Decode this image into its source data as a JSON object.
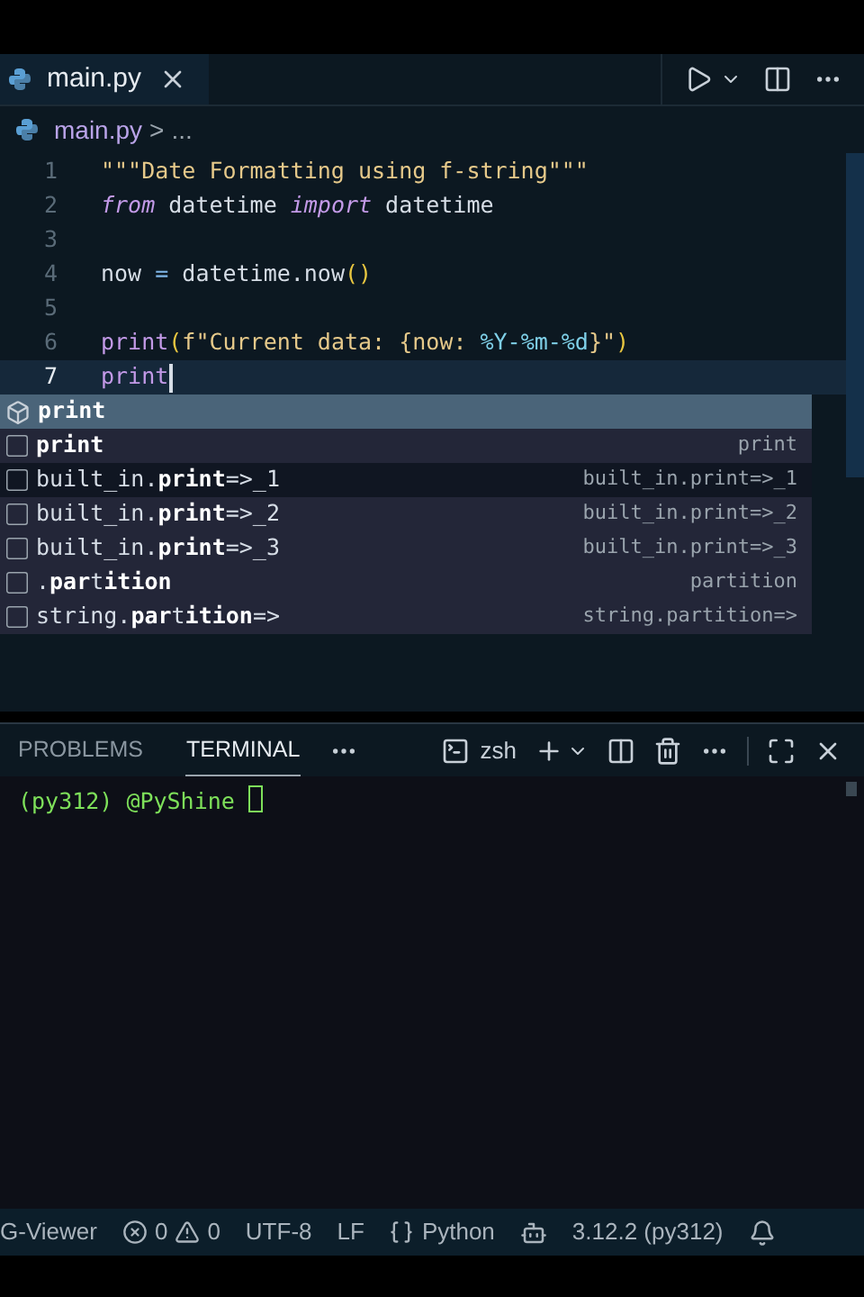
{
  "tabs": [
    {
      "label": "main.py",
      "selected": true
    }
  ],
  "breadcrumb": {
    "file": "main.py",
    "separator": ">",
    "rest": "..."
  },
  "editor": {
    "lines": [
      {
        "number": "1",
        "current": false,
        "tokens": [
          {
            "kind": "string",
            "text": "\"\"\"Date Formatting using f-string\"\"\""
          }
        ]
      },
      {
        "number": "2",
        "current": false,
        "tokens": [
          {
            "kind": "keyword",
            "text": "from"
          },
          {
            "kind": "plain",
            "text": " datetime "
          },
          {
            "kind": "keyword",
            "text": "import"
          },
          {
            "kind": "plain",
            "text": " datetime"
          }
        ]
      },
      {
        "number": "3",
        "current": false
      },
      {
        "number": "4",
        "current": false,
        "tokens": [
          {
            "kind": "plain",
            "text": "now "
          },
          {
            "kind": "operator",
            "text": "="
          },
          {
            "kind": "plain",
            "text": " datetime.now"
          },
          {
            "kind": "paren",
            "text": "()"
          }
        ]
      },
      {
        "number": "5",
        "current": false
      },
      {
        "number": "6",
        "current": false,
        "tokens": [
          {
            "kind": "function",
            "text": "print"
          },
          {
            "kind": "paren",
            "text": "("
          },
          {
            "kind": "string",
            "text": "f\"Current data: "
          },
          {
            "kind": "brace",
            "text": "{now: "
          },
          {
            "kind": "format",
            "text": "%Y-%m-%d"
          },
          {
            "kind": "brace",
            "text": "}"
          },
          {
            "kind": "string",
            "text": "\""
          },
          {
            "kind": "paren",
            "text": ")"
          }
        ]
      },
      {
        "number": "7",
        "current": true,
        "tokens": [
          {
            "kind": "function",
            "text": "print"
          }
        ]
      }
    ]
  },
  "suggestions": [
    {
      "kind": "module",
      "label": "print",
      "bold": true,
      "selected": true,
      "hovered": false
    },
    {
      "kind": "text",
      "label": "print",
      "bold": true,
      "detail": "print",
      "selected": false,
      "hovered": false
    },
    {
      "kind": "text",
      "label": "built_in.**print**=>_1",
      "detail": "built_in.print=>_1",
      "selected": false,
      "hovered": true
    },
    {
      "kind": "text",
      "label": "built_in.**print**=>_2",
      "detail": "built_in.print=>_2",
      "selected": false,
      "hovered": false
    },
    {
      "kind": "text",
      "label": "built_in.**print**=>_3",
      "detail": "built_in.print=>_3",
      "selected": false,
      "hovered": false
    },
    {
      "kind": "text",
      "label": ".**par**t**ition**",
      "detail": "partition",
      "selected": false,
      "hovered": false
    },
    {
      "kind": "text",
      "label": "string.**par**t**ition**=>",
      "detail": "string.partition=>",
      "selected": false,
      "hovered": false
    }
  ],
  "panel": {
    "tabs": [
      {
        "label": "PROBLEMS",
        "selected": false
      },
      {
        "label": "TERMINAL",
        "selected": true
      }
    ],
    "shell": "zsh"
  },
  "terminal": {
    "prompt": "(py312) @PyShine"
  },
  "status_bar": {
    "left": "G-Viewer",
    "errors": "0",
    "warnings": "0",
    "encoding": "UTF-8",
    "eol": "LF",
    "language": "Python",
    "interpreter": "3.12.2 (py312)"
  }
}
